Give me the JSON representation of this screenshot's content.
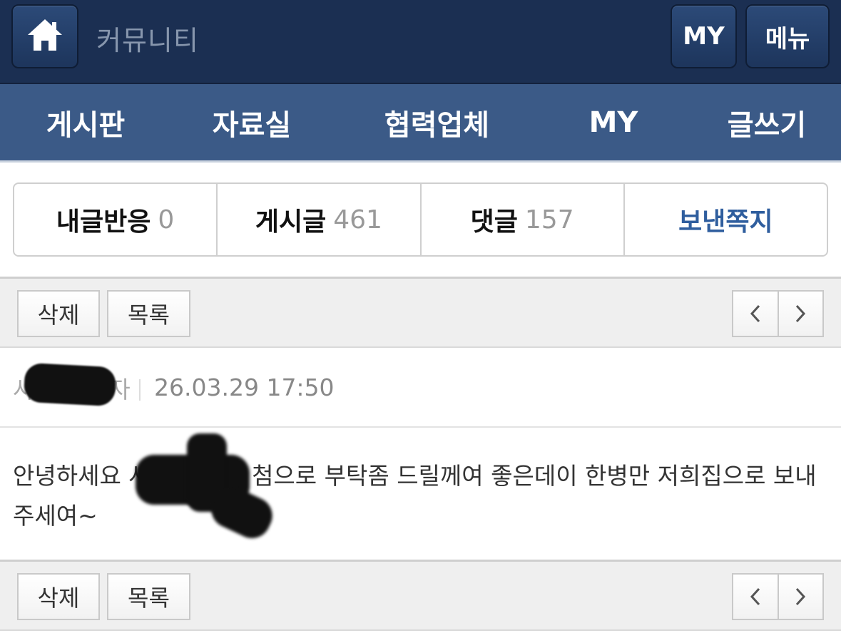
{
  "header": {
    "title": "커뮤니티",
    "my_label": "MY",
    "menu_label": "메뉴"
  },
  "nav": {
    "items": [
      {
        "label": "게시판"
      },
      {
        "label": "자료실"
      },
      {
        "label": "협력업체"
      },
      {
        "label": "MY"
      },
      {
        "label": "글쓰기"
      }
    ]
  },
  "stats": {
    "reactions": {
      "label": "내글반응",
      "count": "0"
    },
    "posts": {
      "label": "게시글",
      "count": "461"
    },
    "comments": {
      "label": "댓글",
      "count": "157"
    },
    "sent": {
      "label": "보낸쪽지"
    }
  },
  "actions": {
    "delete_label": "삭제",
    "list_label": "목록"
  },
  "post": {
    "author_prefix": "사",
    "author_suffix": "자",
    "date": "26.03.29 17:50",
    "body": "안녕하세요 사랑해 자님 첨으로 부탁좀 드릴께여 좋은데이 한병만 저희집으로 보내주세여~"
  },
  "icons": {
    "home": "home-icon",
    "prev": "chevron-left-icon",
    "next": "chevron-right-icon"
  },
  "colors": {
    "header_bg": "#1b2f52",
    "nav_bg": "#3b5a87",
    "accent": "#2f5e9e"
  }
}
